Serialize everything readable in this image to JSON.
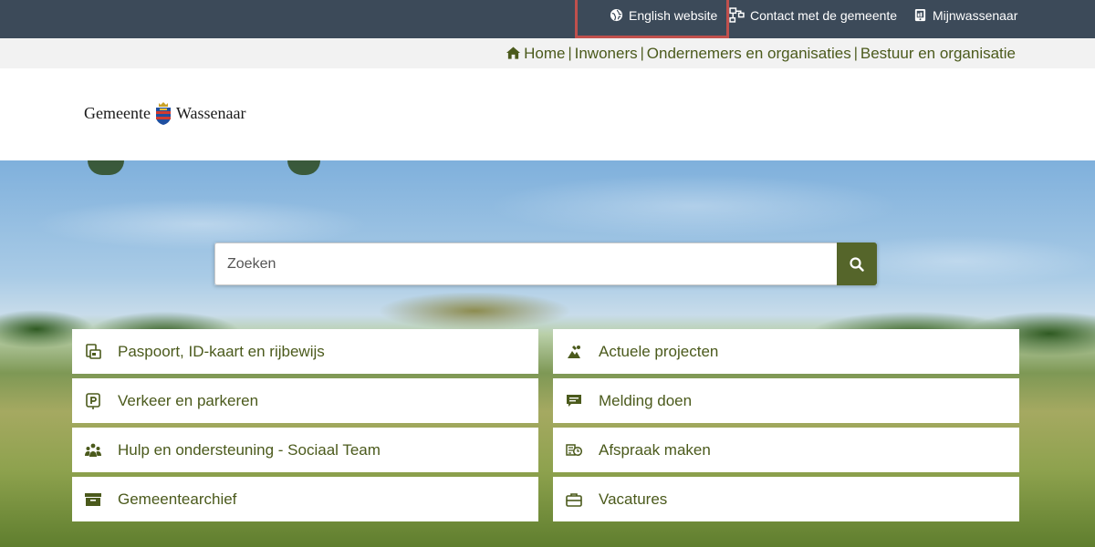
{
  "topbar": {
    "links": [
      {
        "label": "English website",
        "icon": "globe-icon"
      },
      {
        "label": "Contact met de gemeente",
        "icon": "network-icon"
      },
      {
        "label": "Mijnwassenaar",
        "icon": "tablet-icon"
      }
    ]
  },
  "nav": {
    "items": [
      "Home",
      "Inwoners",
      "Ondernemers en organisaties",
      "Bestuur en organisatie"
    ]
  },
  "logo": {
    "left": "Gemeente",
    "right": "Wassenaar"
  },
  "search": {
    "placeholder": "Zoeken"
  },
  "tiles": [
    {
      "label": "Paspoort, ID-kaart en rijbewijs",
      "icon": "id-card-icon"
    },
    {
      "label": "Actuele projecten",
      "icon": "projects-icon"
    },
    {
      "label": "Verkeer en parkeren",
      "icon": "parking-icon"
    },
    {
      "label": "Melding doen",
      "icon": "message-icon"
    },
    {
      "label": "Hulp en ondersteuning - Sociaal Team",
      "icon": "team-icon"
    },
    {
      "label": "Afspraak maken",
      "icon": "appointment-icon"
    },
    {
      "label": "Gemeentearchief",
      "icon": "archive-icon"
    },
    {
      "label": "Vacatures",
      "icon": "briefcase-icon"
    }
  ],
  "colors": {
    "topbar": "#3c4a59",
    "accent": "#55652a",
    "link": "#4b5a1c",
    "highlight": "#c0504d"
  }
}
